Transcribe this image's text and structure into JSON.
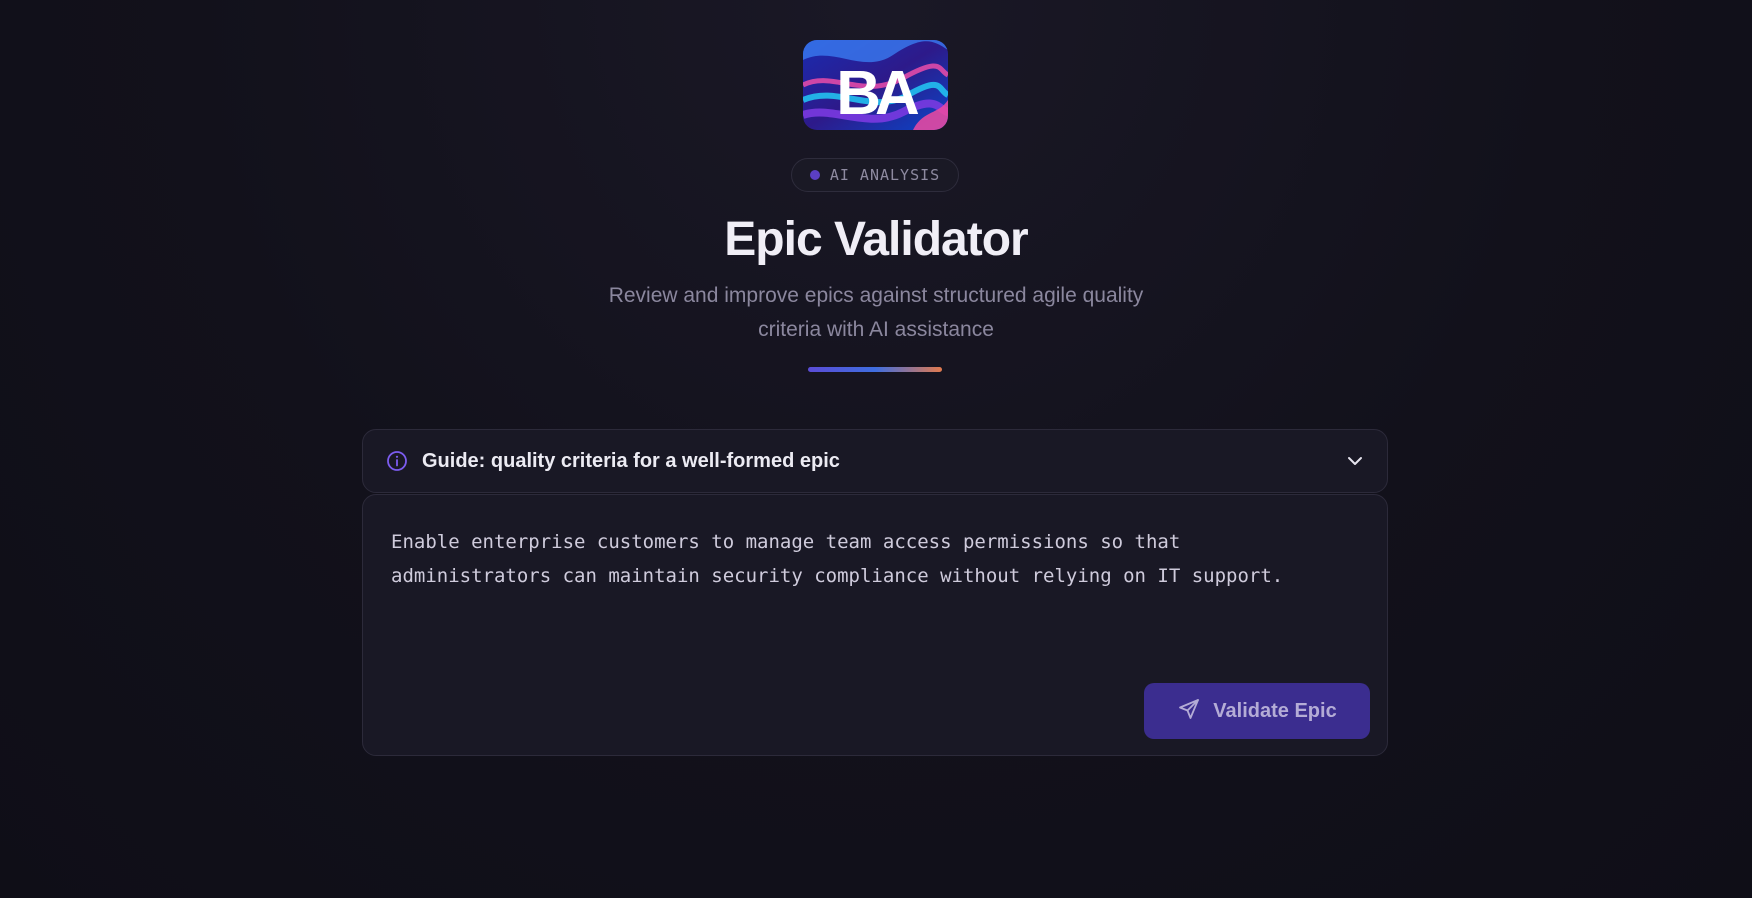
{
  "logo": {
    "text": "BA"
  },
  "badge": {
    "label": "AI ANALYSIS"
  },
  "header": {
    "title": "Epic Validator",
    "subtitle": "Review and improve epics against structured agile quality criteria with AI assistance"
  },
  "guide": {
    "label": "Guide: quality criteria for a well-formed epic",
    "icon": "info-icon",
    "toggle_icon": "chevron-down-icon",
    "expanded": false
  },
  "editor": {
    "value": "Enable enterprise customers to manage team access permissions so that\nadministrators can maintain security compliance without relying on IT support."
  },
  "actions": {
    "validate_label": "Validate Epic",
    "validate_icon": "send-icon"
  },
  "colors": {
    "background": "#11101a",
    "accent": "#5b3fc4",
    "button": "#3b2d8f"
  }
}
